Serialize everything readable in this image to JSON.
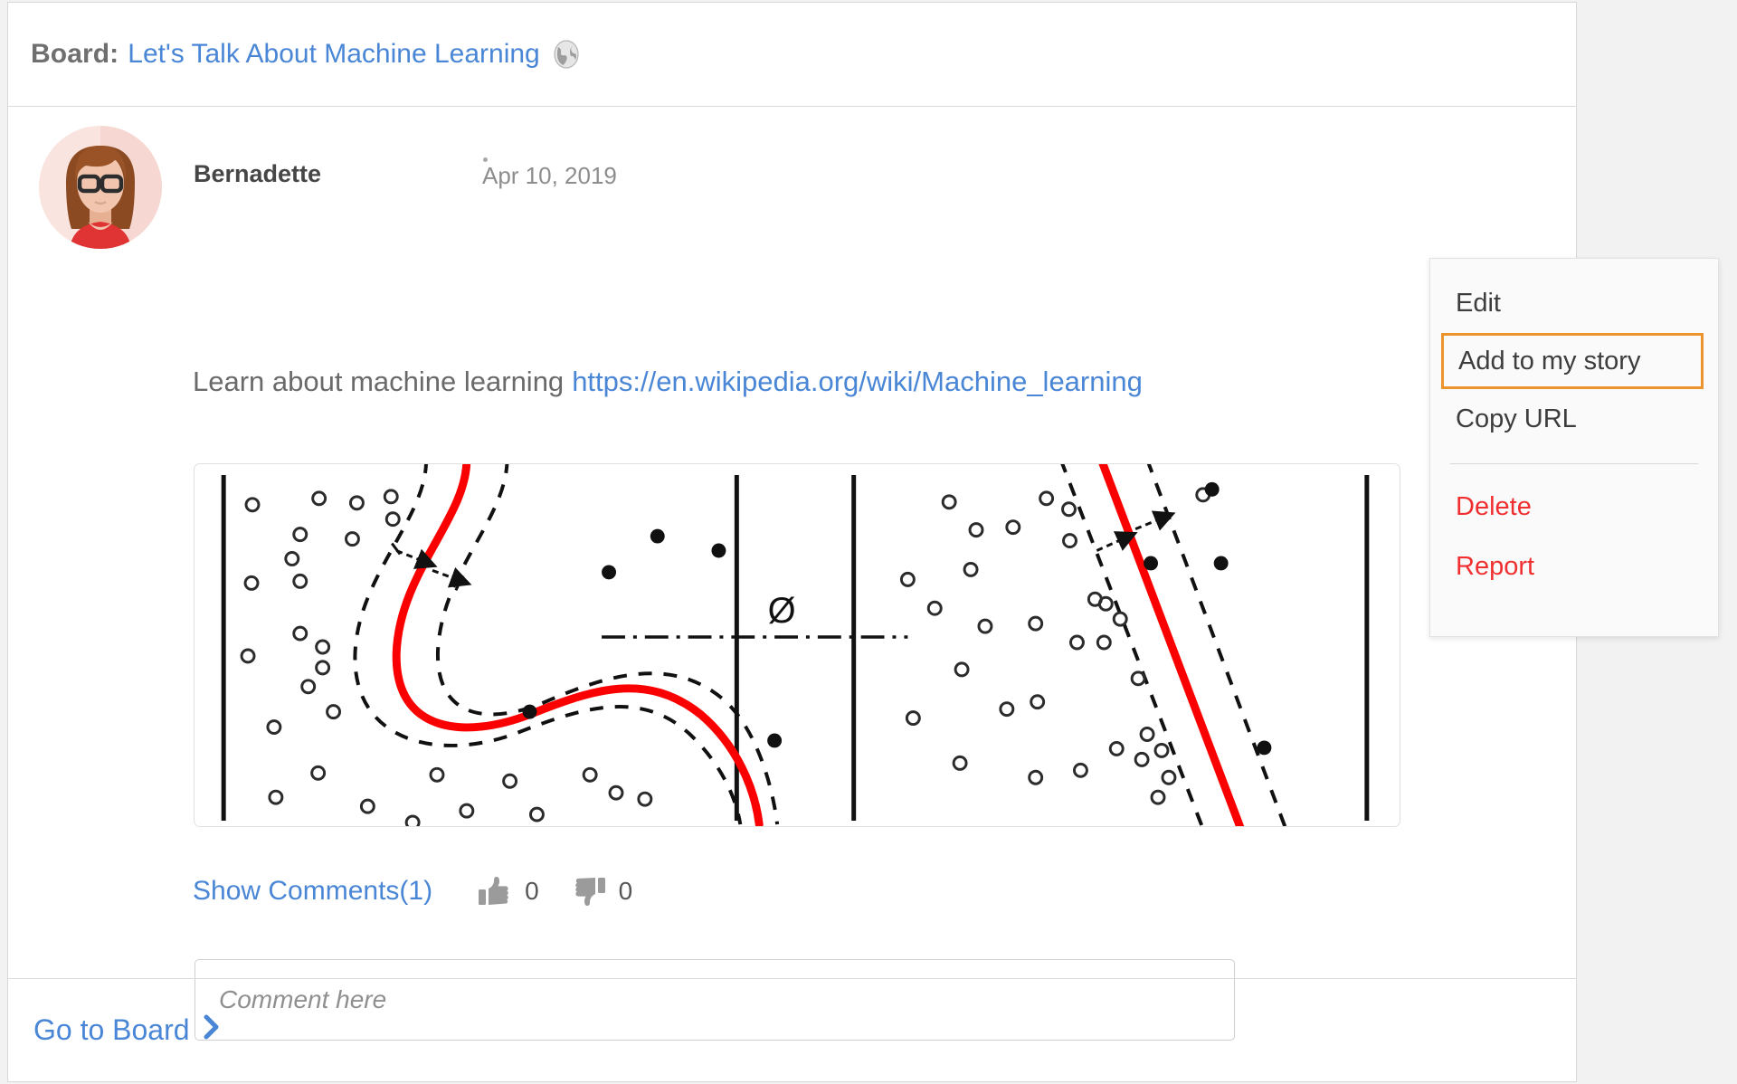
{
  "board": {
    "label": "Board:",
    "title": "Let's Talk About Machine Learning",
    "visibility_icon": "globe-icon"
  },
  "post": {
    "author": "Bernadette",
    "date": "Apr 10, 2019",
    "text_prefix": "Learn about machine learning",
    "url": "https://en.wikipedia.org/wiki/Machine_learning",
    "more_icon": "ellipsis-icon",
    "show_comments_label": "Show Comments(1)",
    "like_icon": "thumbs-up-icon",
    "like_count": "0",
    "dislike_icon": "thumbs-down-icon",
    "dislike_count": "0",
    "comment_placeholder": "Comment here",
    "comment_value": ""
  },
  "media": {
    "alt": "Machine learning classification diagram with decision boundaries, margins and data points",
    "symbol": "Ø"
  },
  "menu": {
    "items": [
      {
        "label": "Edit",
        "style": "normal",
        "selected": false
      },
      {
        "label": "Add to my story",
        "style": "normal",
        "selected": true
      },
      {
        "label": "Copy URL",
        "style": "normal",
        "selected": false
      },
      {
        "label": "Delete",
        "style": "danger",
        "selected": false
      },
      {
        "label": "Report",
        "style": "danger",
        "selected": false
      }
    ]
  },
  "footer": {
    "go_to_board": "Go to Board",
    "chevron_icon": "chevron-right-icon"
  },
  "colors": {
    "link": "#4a86d6",
    "danger": "#f03030",
    "highlight": "#eb942c",
    "muted": "#8d8d8d",
    "diagram_accent": "#fb0000"
  }
}
